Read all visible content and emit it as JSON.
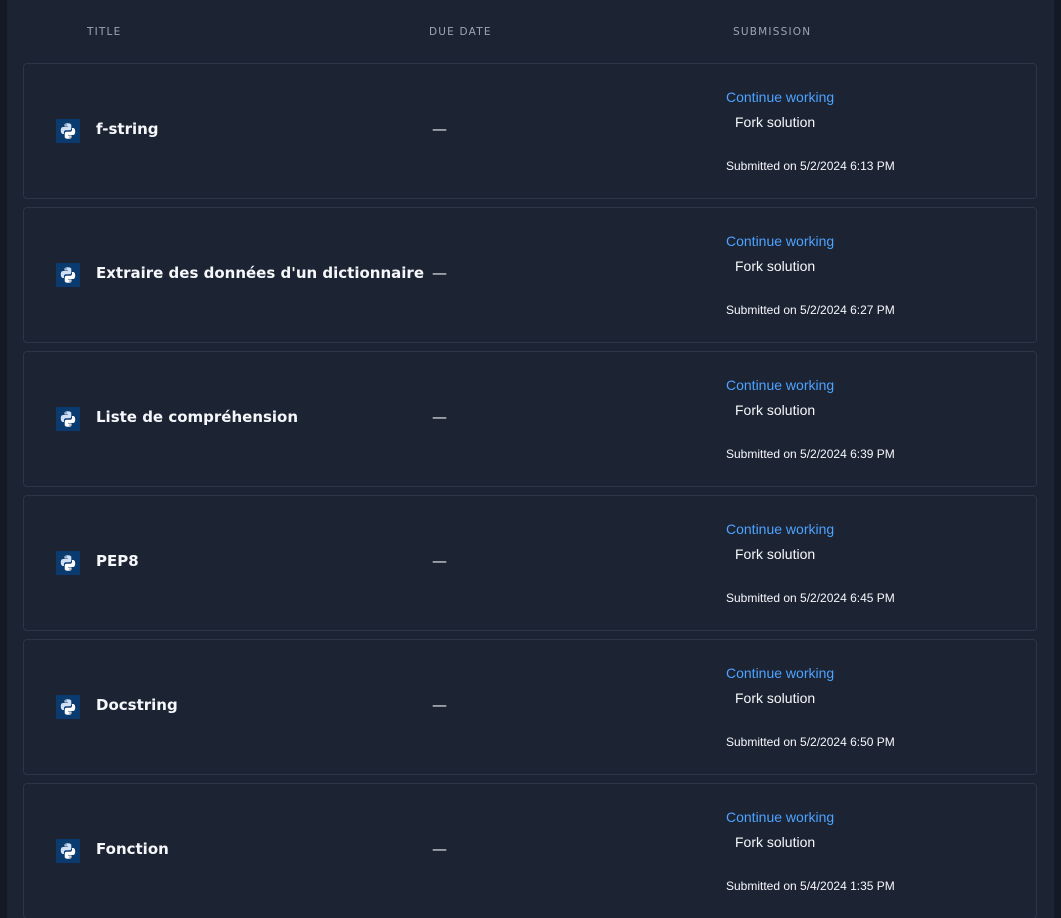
{
  "columns": {
    "title": "TITLE",
    "due_date": "DUE DATE",
    "submission": "SUBMISSION"
  },
  "icon": "python-logo-icon",
  "colors": {
    "background": "#1c2333",
    "link": "#4da3ff",
    "text": "#f5f7fa",
    "header_text": "#9da5b4",
    "row_border": "#2d3548",
    "icon_background": "#0b3a6e"
  },
  "rows": [
    {
      "title": "f-string",
      "due_date": "—",
      "continue_label": "Continue working",
      "fork_label": "Fork solution",
      "submitted": "Submitted on 5/2/2024 6:13 PM"
    },
    {
      "title": "Extraire des données d'un dictionnaire",
      "due_date": "—",
      "continue_label": "Continue working",
      "fork_label": "Fork solution",
      "submitted": "Submitted on 5/2/2024 6:27 PM"
    },
    {
      "title": "Liste de compréhension",
      "due_date": "—",
      "continue_label": "Continue working",
      "fork_label": "Fork solution",
      "submitted": "Submitted on 5/2/2024 6:39 PM"
    },
    {
      "title": "PEP8",
      "due_date": "—",
      "continue_label": "Continue working",
      "fork_label": "Fork solution",
      "submitted": "Submitted on 5/2/2024 6:45 PM"
    },
    {
      "title": "Docstring",
      "due_date": "—",
      "continue_label": "Continue working",
      "fork_label": "Fork solution",
      "submitted": "Submitted on 5/2/2024 6:50 PM"
    },
    {
      "title": "Fonction",
      "due_date": "—",
      "continue_label": "Continue working",
      "fork_label": "Fork solution",
      "submitted": "Submitted on 5/4/2024 1:35 PM"
    }
  ]
}
